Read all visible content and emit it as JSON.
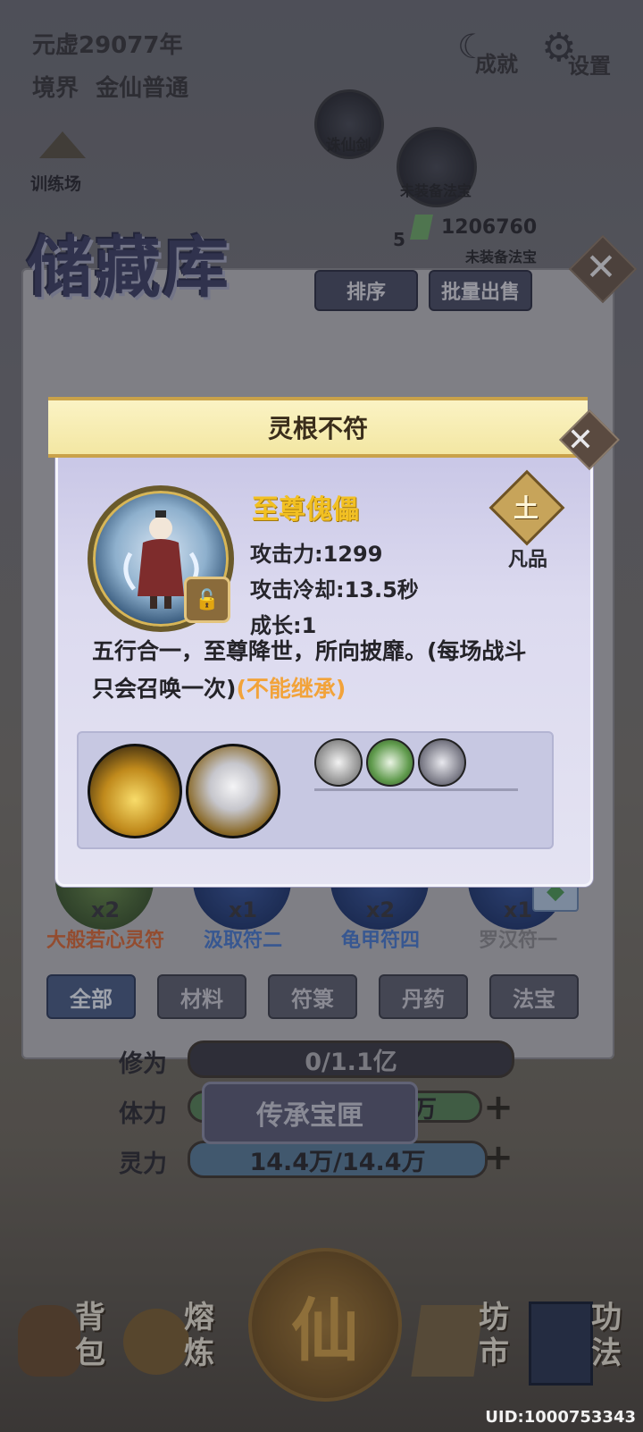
{
  "hud": {
    "year": "元虚29077年",
    "realm_label": "境界",
    "realm_value": "金仙普通",
    "achievement": "成就",
    "settings": "设置",
    "training": "训练场"
  },
  "equipment": {
    "slot1": "诛仙剑",
    "slot2": "未装备法宝",
    "slot3": "未装备法宝",
    "stone_count": "1206760",
    "badge": "5"
  },
  "storage": {
    "title": "储藏库",
    "sort_button": "排序",
    "bulk_sell_button": "批量出售",
    "items": [
      {
        "count": "x2",
        "name": "大般若心灵符",
        "color": "#d86a3a"
      },
      {
        "count": "x1",
        "name": "汲取符二",
        "color": "#4a7bd0"
      },
      {
        "count": "x2",
        "name": "龟甲符四",
        "color": "#4a7bd0"
      },
      {
        "count": "x1",
        "name": "罗汉符一",
        "color": "#8a8a90"
      }
    ],
    "categories": [
      "全部",
      "材料",
      "符箓",
      "丹药",
      "法宝"
    ]
  },
  "stats": {
    "cultivation_label": "修为",
    "cultivation_value": "0/1.1亿",
    "stamina_label": "体力",
    "stamina_value": "万",
    "spirit_label": "灵力",
    "spirit_value": "14.4万/14.4万",
    "inherit_button": "传承宝匣"
  },
  "nav": {
    "bag": [
      "背",
      "包"
    ],
    "smelt": [
      "熔",
      "炼"
    ],
    "center": "仙",
    "market": [
      "坊",
      "市"
    ],
    "skills": [
      "功",
      "法"
    ]
  },
  "uid": "UID:1000753343",
  "modal": {
    "header": "灵根不符",
    "name": "至尊傀儡",
    "attack": "攻击力:1299",
    "cooldown": "攻击冷却:13.5秒",
    "growth": "成长:1",
    "grade_glyph": "土",
    "grade": "凡品",
    "description": "五行合一，至尊降世，所向披靡。(每场战斗只会召唤一次)",
    "note": "(不能继承)"
  }
}
